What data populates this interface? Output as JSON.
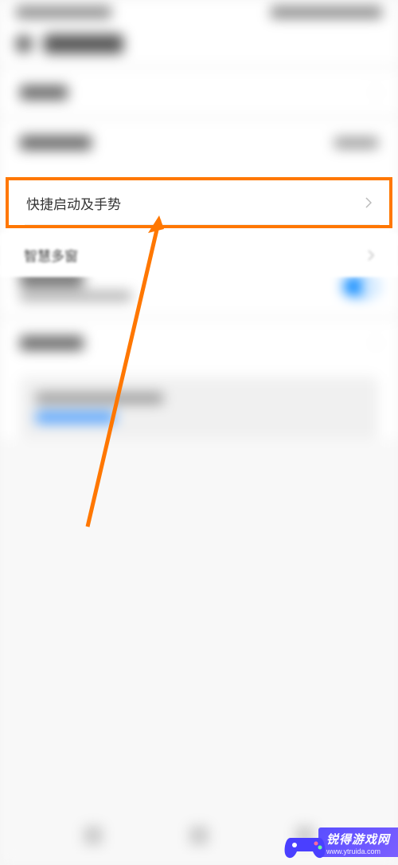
{
  "highlighted": {
    "label": "快捷启动及手势"
  },
  "row_below": {
    "label": "智慧多窗"
  },
  "watermark": {
    "title": "锐得游戏网",
    "url": "www.ytruida.com"
  },
  "highlight_color": "#ff7700",
  "toggle_color": "#0084ff"
}
